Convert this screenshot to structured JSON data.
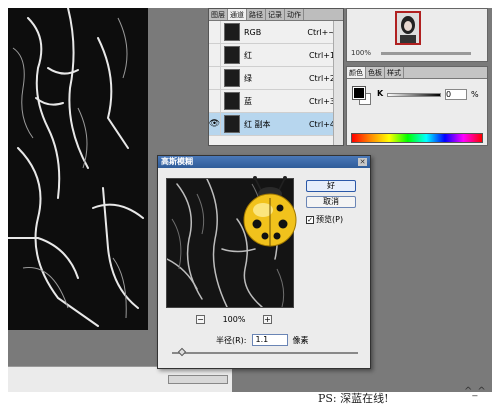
{
  "channels_panel": {
    "tabs": [
      "图层",
      "通道",
      "路径",
      "记录",
      "动作"
    ],
    "active_tab_index": 1,
    "rows": [
      {
        "name": "RGB",
        "shortcut": "Ctrl+~",
        "visible": false,
        "selected": false
      },
      {
        "name": "红",
        "shortcut": "Ctrl+1",
        "visible": false,
        "selected": false
      },
      {
        "name": "绿",
        "shortcut": "Ctrl+2",
        "visible": false,
        "selected": false
      },
      {
        "name": "蓝",
        "shortcut": "Ctrl+3",
        "visible": false,
        "selected": false
      },
      {
        "name": "红 副本",
        "shortcut": "Ctrl+4",
        "visible": true,
        "selected": true
      }
    ]
  },
  "navigator": {
    "zoom": "100%"
  },
  "color_panel": {
    "tabs": [
      "颜色",
      "色板",
      "样式"
    ],
    "channel_label": "K",
    "value": "0",
    "unit": "%",
    "fg_color": "#000000",
    "bg_color": "#ffffff"
  },
  "dialog": {
    "title": "高斯模糊",
    "ok_label": "好",
    "cancel_label": "取消",
    "preview_label": "预览(P)",
    "preview_checked": true,
    "zoom_minus": "−",
    "zoom_level": "100%",
    "zoom_plus": "+",
    "radius_label": "半径(R):",
    "radius_value": "1.1",
    "radius_unit": "像素",
    "radius_level": 0.02
  },
  "footer": {
    "credit": "PS: 深蓝在线!",
    "emoticon": "^_^"
  },
  "colors": {
    "workspace": "#7a7a7a",
    "selected_row": "#b7d6ee",
    "title_bar": "#3a68a8"
  }
}
